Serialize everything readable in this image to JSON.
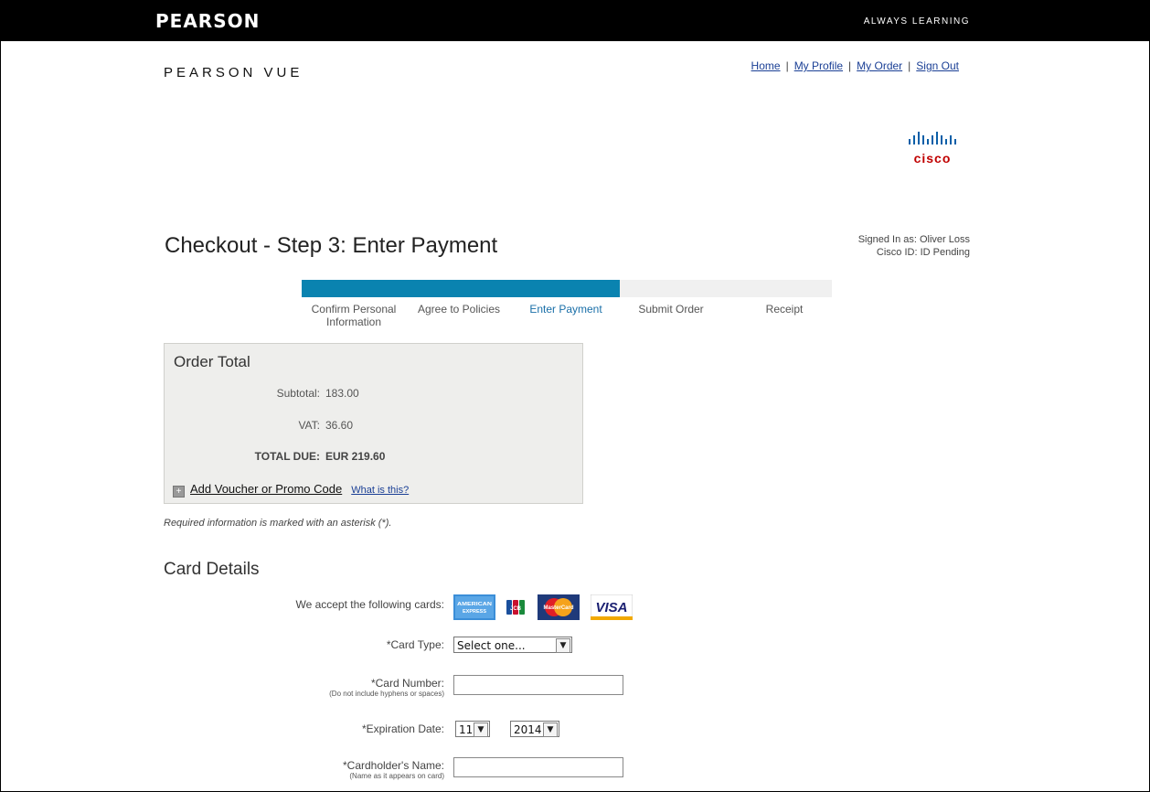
{
  "header": {
    "brand": "PEARSON",
    "tagline": "ALWAYS LEARNING",
    "sub_brand": "PEARSON VUE"
  },
  "nav": {
    "links": [
      "Home",
      "My Profile",
      "My Order",
      "Sign Out"
    ]
  },
  "partner_logo": {
    "text": "cisco",
    "icon": "cisco-bars-icon",
    "color": "#c00000"
  },
  "page": {
    "title": "Checkout - Step 3: Enter Payment",
    "signed_in": "Signed In as: Oliver Loss",
    "cisco_id": "Cisco ID: ID Pending"
  },
  "progress": {
    "steps": [
      "Confirm Personal Information",
      "Agree to Policies",
      "Enter Payment",
      "Submit Order",
      "Receipt"
    ],
    "active_index": 2,
    "fraction": 0.6,
    "color": "#0a83b0"
  },
  "order": {
    "title": "Order Total",
    "subtotal_label": "Subtotal:",
    "subtotal_value": "183.00",
    "vat_label": "VAT:",
    "vat_value": "36.60",
    "total_label": "TOTAL DUE:",
    "total_value": "EUR 219.60",
    "voucher_link": "Add Voucher or Promo Code",
    "voucher_help": "What is this?"
  },
  "required_note": "Required information is marked with an asterisk (*).",
  "card": {
    "title": "Card Details",
    "accepted_label": "We accept the following cards:",
    "logos": [
      "AMERICAN EXPRESS",
      "JCB",
      "MasterCard",
      "VISA"
    ],
    "card_type_label": "*Card Type:",
    "card_type_value": "Select one...",
    "card_number_label": "*Card Number:",
    "card_number_note": "(Do not include hyphens or spaces)",
    "card_number_value": "",
    "expiration_label": "*Expiration Date:",
    "exp_month": "11",
    "exp_year": "2014",
    "holder_label": "*Cardholder's Name:",
    "holder_note": "(Name as it appears on card)",
    "holder_value": ""
  }
}
